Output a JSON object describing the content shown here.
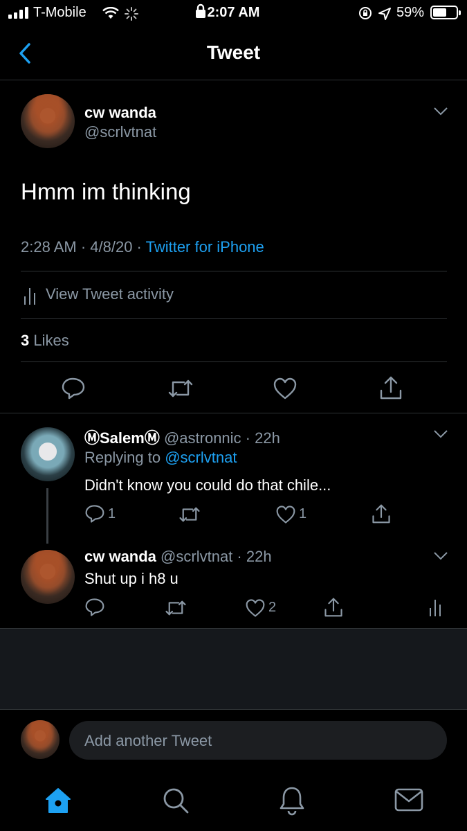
{
  "status_bar": {
    "carrier": "T-Mobile",
    "time": "2:07 AM",
    "battery_percent": "59%",
    "battery_level": 0.59
  },
  "header": {
    "title": "Tweet"
  },
  "tweet": {
    "display_name": "cw wanda",
    "handle": "@scrlvtnat",
    "text": "Hmm im thinking",
    "timestamp": "2:28 AM · 4/8/20 · ",
    "source": "Twitter for iPhone",
    "activity_label": "View Tweet activity",
    "likes_count": "3",
    "likes_label": " Likes"
  },
  "replies": [
    {
      "display_name": "ⓂSalemⓂ",
      "handle": "@astronnic",
      "time": " · 22h",
      "replying_prefix": "Replying to ",
      "replying_to": "@scrlvtnat",
      "text": "Didn't know you could do that chile...",
      "reply_count": "1",
      "like_count": "1"
    },
    {
      "display_name": "cw wanda",
      "handle": "@scrlvtnat",
      "time": " · 22h",
      "text": "Shut up i h8 u",
      "like_count": "2"
    }
  ],
  "composer": {
    "placeholder": "Add another Tweet"
  },
  "tab_bar": [
    "home-icon",
    "search-icon",
    "notifications-icon",
    "messages-icon"
  ],
  "colors": {
    "accent": "#1da1f2",
    "muted": "#8b98a5",
    "divider": "#2f3336"
  }
}
